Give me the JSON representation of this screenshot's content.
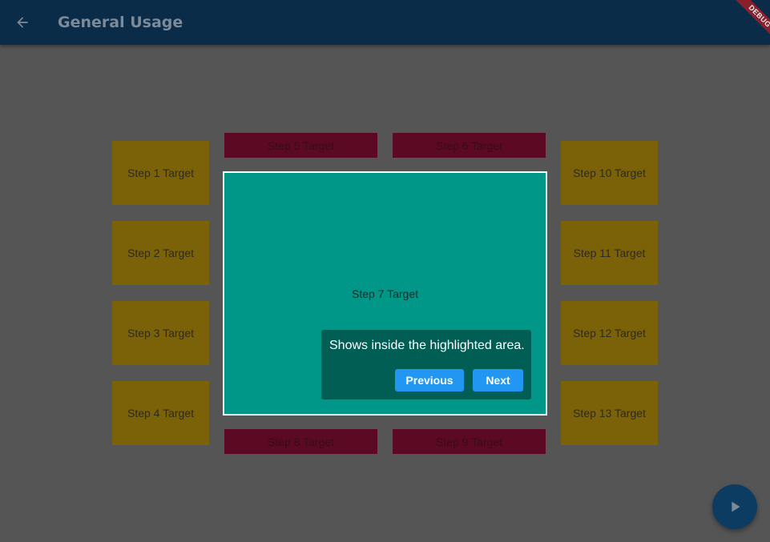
{
  "appbar": {
    "title": "General Usage",
    "back_icon": "arrow-back-icon",
    "color": "#0a2c49"
  },
  "debug_banner": {
    "label": "DEBUG"
  },
  "targets": {
    "step1": "Step 1 Target",
    "step2": "Step 2 Target",
    "step3": "Step 3 Target",
    "step4": "Step 4 Target",
    "step5": "Step 5 Target",
    "step6": "Step 6 Target",
    "step7": "Step 7 Target",
    "step8": "Step 8 Target",
    "step9": "Step 9 Target",
    "step10": "Step 10 Target",
    "step11": "Step 11 Target",
    "step12": "Step 12 Target",
    "step13": "Step 13 Target"
  },
  "tooltip": {
    "text": "Shows inside the highlighted area.",
    "previous_label": "Previous",
    "next_label": "Next"
  },
  "fab": {
    "icon": "play-arrow-icon"
  },
  "colors": {
    "overlay": "#555555",
    "highlight": "#009688",
    "button": "#2196f3",
    "yellow_target": "#7b6208",
    "magenta_target": "#5c0a23"
  }
}
